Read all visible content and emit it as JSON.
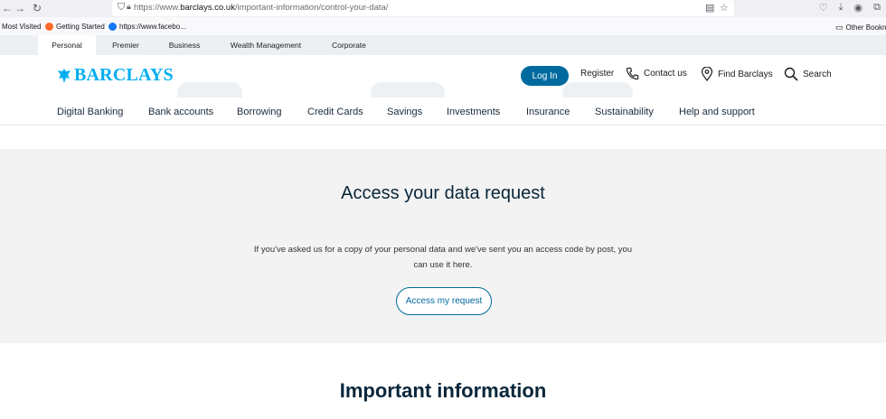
{
  "browser": {
    "url_prefix": "https://www.",
    "url_domain": "barclays.co.uk",
    "url_path": "/important-information/control-your-data/"
  },
  "bookmarks": [
    {
      "label": "Most Visited"
    },
    {
      "label": "Getting Started"
    },
    {
      "label": "https://www.facebo..."
    },
    {
      "label": "Other Bookma"
    }
  ],
  "audience_tabs": [
    {
      "label": "Personal",
      "active": true
    },
    {
      "label": "Premier"
    },
    {
      "label": "Business"
    },
    {
      "label": "Wealth Management"
    },
    {
      "label": "Corporate"
    }
  ],
  "header": {
    "logo_text": "BARCLAYS",
    "login_label": "Log In",
    "register_label": "Register",
    "contact_label": "Contact us",
    "find_label": "Find Barclays",
    "search_label": "Search"
  },
  "nav": [
    {
      "label": "Digital Banking"
    },
    {
      "label": "Bank accounts"
    },
    {
      "label": "Borrowing"
    },
    {
      "label": "Credit Cards"
    },
    {
      "label": "Savings"
    },
    {
      "label": "Investments"
    },
    {
      "label": "Insurance"
    },
    {
      "label": "Sustainability"
    },
    {
      "label": "Help and support"
    }
  ],
  "request": {
    "title": "Access your data request",
    "body": "If you've asked us for a copy of your personal data and we've sent you an access code by post, you can use it here.",
    "button_label": "Access my request"
  },
  "important": {
    "title": "Important information"
  },
  "colors": {
    "brand": "#00aeef",
    "primary_button": "#006a9e",
    "section_bg": "#f3f3f3"
  }
}
